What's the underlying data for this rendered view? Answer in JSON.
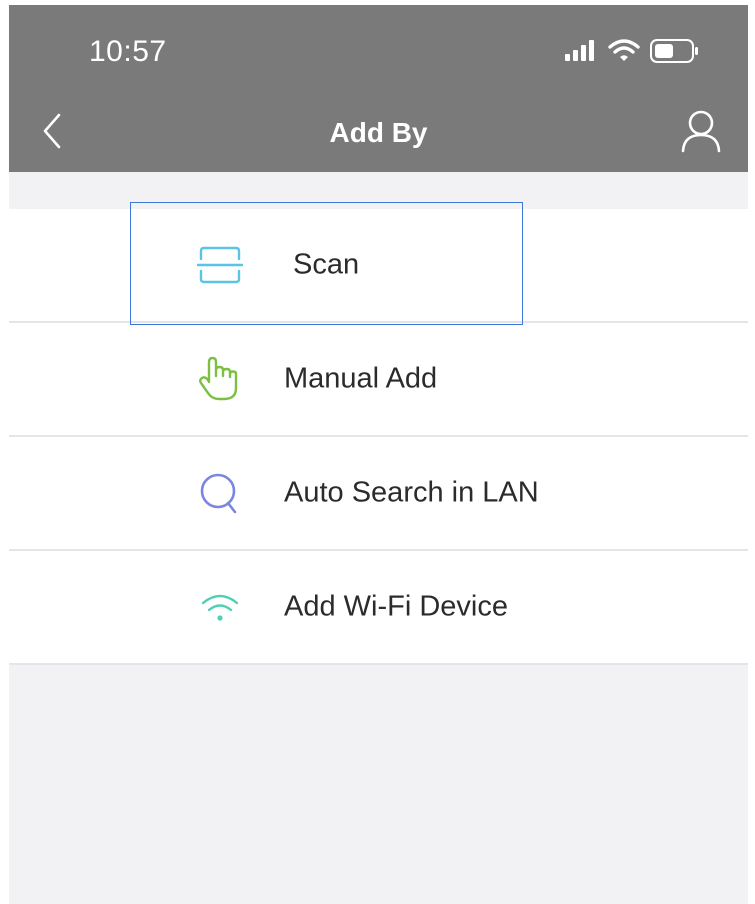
{
  "status_bar": {
    "time": "10:57"
  },
  "nav": {
    "title": "Add By",
    "back_icon": "chevron-left-icon",
    "user_icon": "user-icon"
  },
  "menu": {
    "items": [
      {
        "label": "Scan",
        "icon": "scan-icon",
        "icon_color": "#5bc4e6"
      },
      {
        "label": "Manual Add",
        "icon": "hand-pointer-icon",
        "icon_color": "#7bc043"
      },
      {
        "label": "Auto Search in LAN",
        "icon": "search-icon",
        "icon_color": "#7b86e0"
      },
      {
        "label": "Add Wi-Fi Device",
        "icon": "wifi-icon",
        "icon_color": "#4fcfb3"
      }
    ]
  },
  "colors": {
    "header": "#7a7a7a",
    "background": "#f2f2f5",
    "focus": "#3b78d8"
  }
}
